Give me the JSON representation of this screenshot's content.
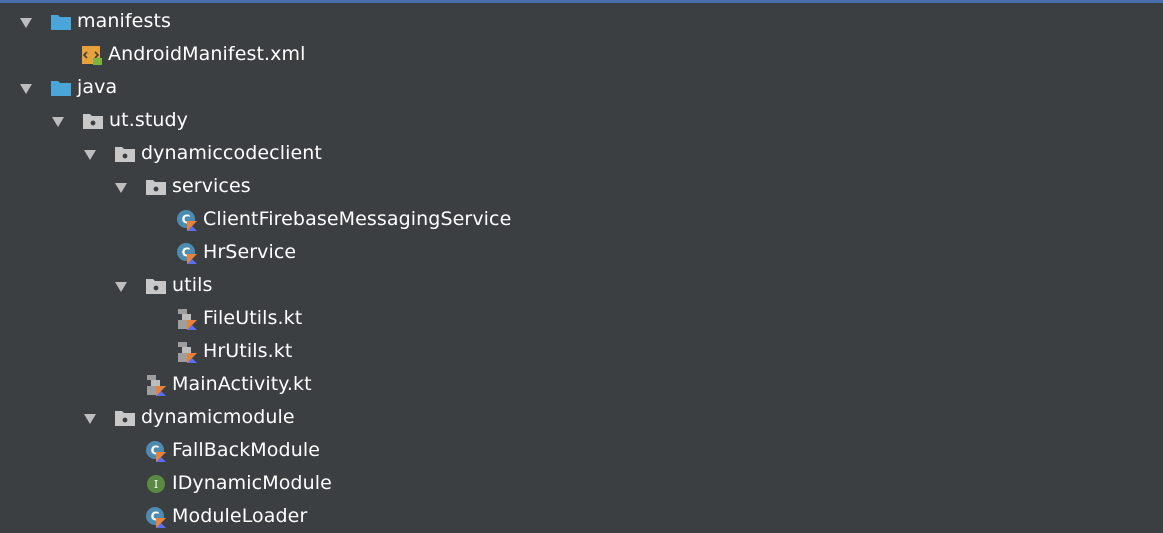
{
  "tree": {
    "manifests": {
      "label": "manifests"
    },
    "android_manifest": {
      "label": "AndroidManifest.xml"
    },
    "java": {
      "label": "java"
    },
    "ut_study": {
      "label": "ut.study"
    },
    "dynamiccodeclient": {
      "label": "dynamiccodeclient"
    },
    "services": {
      "label": "services"
    },
    "client_firebase": {
      "label": "ClientFirebaseMessagingService"
    },
    "hr_service": {
      "label": "HrService"
    },
    "utils": {
      "label": "utils"
    },
    "file_utils": {
      "label": "FileUtils.kt"
    },
    "hr_utils": {
      "label": "HrUtils.kt"
    },
    "main_activity": {
      "label": "MainActivity.kt"
    },
    "dynamicmodule": {
      "label": "dynamicmodule"
    },
    "fallback_module": {
      "label": "FallBackModule"
    },
    "idynamic_module": {
      "label": "IDynamicModule"
    },
    "module_loader": {
      "label": "ModuleLoader"
    }
  },
  "icons": {
    "folder": "folder-icon",
    "package": "package-folder-icon",
    "kotlin_class": "kotlin-class-icon",
    "kotlin_interface": "kotlin-interface-icon",
    "kotlin_file": "kotlin-file-icon",
    "manifest": "manifest-xml-icon",
    "expand_arrow": "expand-arrow-icon"
  },
  "colors": {
    "background": "#3c3f41",
    "text": "#ffffff",
    "folder": "#4aa6d8",
    "package": "#c8c8c8",
    "class_badge": "#4e8bb0",
    "interface_badge": "#5a8a41",
    "kotlin_orange": "#e9813a",
    "kotlin_blue": "#5b6ff0"
  }
}
